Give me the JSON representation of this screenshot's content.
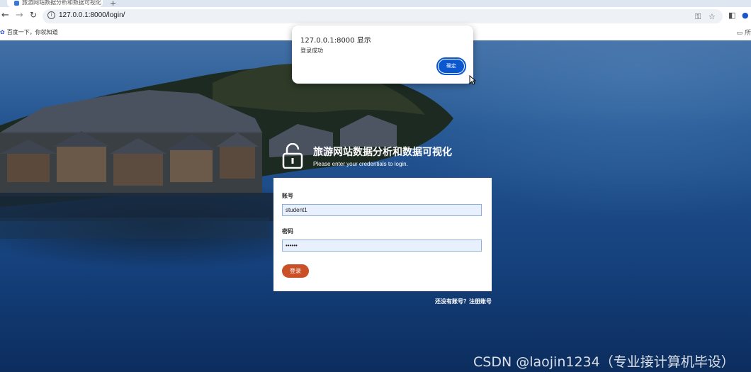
{
  "browser": {
    "tab_title": "旅游网站数据分析和数据可视化",
    "new_tab_label": "+",
    "url": "127.0.0.1:8000/login/",
    "bookmark": "百度一下，你就知道",
    "bookmarks_folder": "所"
  },
  "page": {
    "brand_title": "旅游网站数据分析和数据可视化",
    "brand_subtitle": "Please enter your credentials to login.",
    "username_label": "账号",
    "username_value": "student1",
    "password_label": "密码",
    "password_value": "••••••",
    "login_button": "登录",
    "register_link": "还没有账号？注册账号"
  },
  "dialog": {
    "title": "127.0.0.1:8000 显示",
    "message": "登录成功",
    "ok_button": "确定"
  },
  "watermark": "CSDN @laojin1234（专业接计算机毕设）",
  "colors": {
    "login_button": "#c95027",
    "dialog_ok": "#0b57d0",
    "field_bg": "#e8f0fe"
  }
}
